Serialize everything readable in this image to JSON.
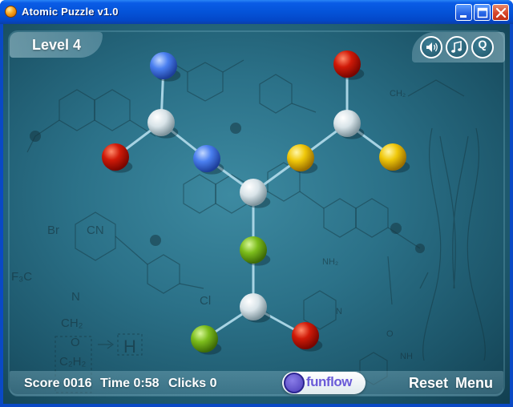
{
  "window": {
    "title": "Atomic Puzzle v1.0",
    "controls": [
      "minimize-icon",
      "maximize-icon",
      "close-icon"
    ]
  },
  "game": {
    "level_label": "Level 4",
    "controls": [
      "sound-icon",
      "music-note-icon",
      "quit-icon"
    ],
    "quit_letter": "Q"
  },
  "molecule": {
    "atoms": [
      {
        "id": "a1",
        "color": "blue"
      },
      {
        "id": "a2",
        "color": "white"
      },
      {
        "id": "a3",
        "color": "red"
      },
      {
        "id": "a4",
        "color": "blue"
      },
      {
        "id": "a5",
        "color": "white"
      },
      {
        "id": "a6",
        "color": "yellow"
      },
      {
        "id": "a7",
        "color": "white"
      },
      {
        "id": "a8",
        "color": "red"
      },
      {
        "id": "a9",
        "color": "yellow"
      },
      {
        "id": "a10",
        "color": "green"
      },
      {
        "id": "a11",
        "color": "white"
      },
      {
        "id": "a12",
        "color": "green"
      },
      {
        "id": "a13",
        "color": "red"
      }
    ],
    "bonds": [
      [
        "a1",
        "a2"
      ],
      [
        "a2",
        "a3"
      ],
      [
        "a2",
        "a4"
      ],
      [
        "a4",
        "a5"
      ],
      [
        "a5",
        "a6"
      ],
      [
        "a6",
        "a7"
      ],
      [
        "a7",
        "a8"
      ],
      [
        "a7",
        "a9"
      ],
      [
        "a5",
        "a10"
      ],
      [
        "a10",
        "a11"
      ],
      [
        "a11",
        "a12"
      ],
      [
        "a11",
        "a13"
      ]
    ]
  },
  "background_labels": [
    "Br",
    "CN",
    "F₃C",
    "N",
    "Cl",
    "CH₂",
    "O",
    "C₂H₂",
    "H",
    "NH₂",
    "N",
    "NH",
    "O",
    "CH₂"
  ],
  "status": {
    "score": "Score 0016",
    "time": "Time 0:58",
    "clicks": "Clicks 0"
  },
  "logo": {
    "text": "funflow"
  },
  "buttons": {
    "reset": "Reset",
    "menu": "Menu"
  },
  "colors": {
    "titlebar": "#0453d8",
    "stage": "#2b7188",
    "red": "#d01a08",
    "blue": "#4a7ff0",
    "yellow": "#f0c80a",
    "green": "#7cbd1c",
    "white": "#e6eef2",
    "bond": "#a7d3e3"
  }
}
